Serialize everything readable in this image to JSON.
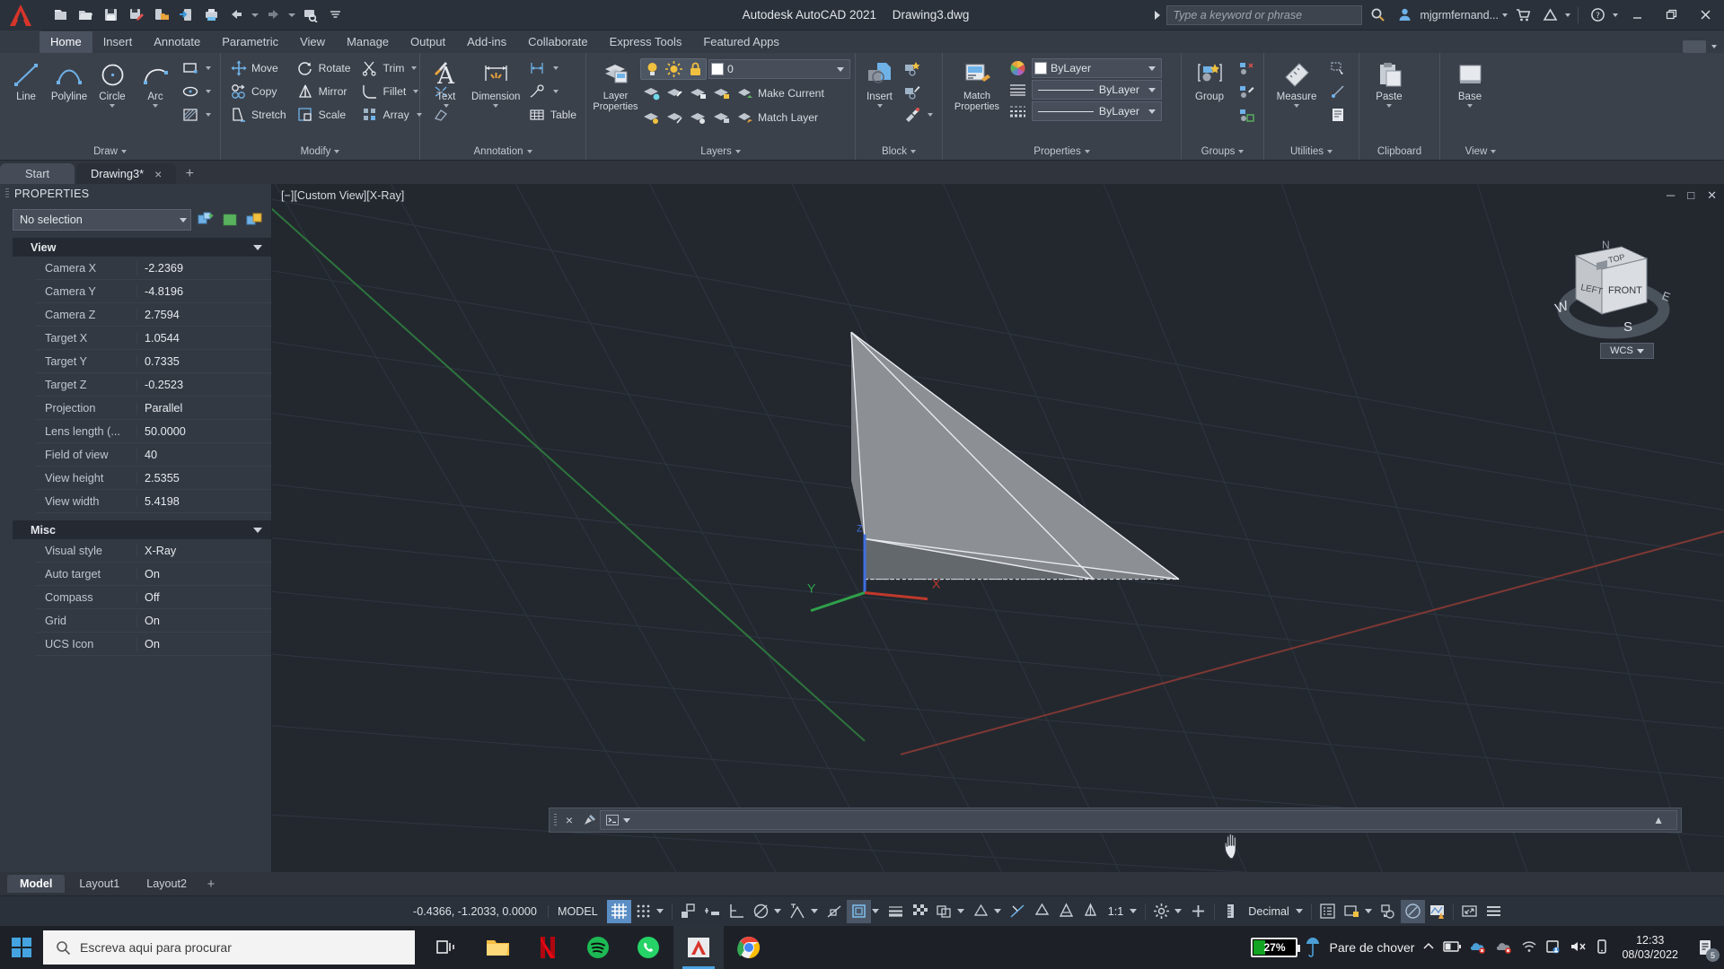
{
  "titlebar": {
    "app_title": "Autodesk AutoCAD 2021",
    "file_name": "Drawing3.dwg",
    "search_placeholder": "Type a keyword or phrase",
    "user_name": "mjgrmfernand...",
    "quick_access": [
      {
        "name": "new-file-icon",
        "label": "New"
      },
      {
        "name": "open-file-icon",
        "label": "Open"
      },
      {
        "name": "save-icon",
        "label": "Save"
      },
      {
        "name": "save-as-icon",
        "label": "Save As"
      },
      {
        "name": "save-to-web-icon",
        "label": "Save to Web & Mobile"
      },
      {
        "name": "open-from-web-icon",
        "label": "Open from Web & Mobile"
      },
      {
        "name": "plot-icon",
        "label": "Plot"
      },
      {
        "name": "undo-icon",
        "label": "Undo"
      },
      {
        "name": "redo-icon",
        "label": "Redo"
      },
      {
        "name": "plot-preview-icon",
        "label": "Plot Preview"
      },
      {
        "name": "customize-qat-icon",
        "label": "Customize Quick Access Toolbar"
      }
    ],
    "window_buttons": [
      "minimize",
      "restore",
      "close"
    ]
  },
  "ribbon": {
    "tabs": [
      {
        "label": "Home",
        "active": true
      },
      {
        "label": "Insert",
        "active": false
      },
      {
        "label": "Annotate",
        "active": false
      },
      {
        "label": "Parametric",
        "active": false
      },
      {
        "label": "View",
        "active": false
      },
      {
        "label": "Manage",
        "active": false
      },
      {
        "label": "Output",
        "active": false
      },
      {
        "label": "Add-ins",
        "active": false
      },
      {
        "label": "Collaborate",
        "active": false
      },
      {
        "label": "Express Tools",
        "active": false
      },
      {
        "label": "Featured Apps",
        "active": false
      }
    ],
    "panels": {
      "draw": {
        "title": "Draw",
        "big": [
          {
            "label": "Line",
            "icon": "line-icon"
          },
          {
            "label": "Polyline",
            "icon": "polyline-icon"
          },
          {
            "label": "Circle",
            "icon": "circle-icon"
          },
          {
            "label": "Arc",
            "icon": "arc-icon"
          }
        ],
        "small": [
          {
            "icon": "rectangle-icon",
            "label": ""
          },
          {
            "icon": "ellipse-icon",
            "label": ""
          },
          {
            "icon": "hatch-icon",
            "label": ""
          }
        ]
      },
      "modify": {
        "title": "Modify",
        "items": [
          {
            "label": "Move",
            "icon": "move-icon"
          },
          {
            "label": "Rotate",
            "icon": "rotate-icon"
          },
          {
            "label": "Trim",
            "icon": "trim-icon"
          },
          {
            "label": "Copy",
            "icon": "copy-icon"
          },
          {
            "label": "Mirror",
            "icon": "mirror-icon"
          },
          {
            "label": "Fillet",
            "icon": "fillet-icon"
          },
          {
            "label": "Stretch",
            "icon": "stretch-icon"
          },
          {
            "label": "Scale",
            "icon": "scale-icon"
          },
          {
            "label": "Array",
            "icon": "array-icon"
          }
        ],
        "extra": [
          {
            "icon": "paint-brush-icon"
          },
          {
            "icon": "erase-icon"
          },
          {
            "icon": "explode-icon"
          }
        ]
      },
      "annotation": {
        "title": "Annotation",
        "text_label": "Text",
        "dimension_label": "Dimension",
        "table_label": "Table"
      },
      "layers": {
        "title": "Layers",
        "layer_properties_label": "Layer\nProperties",
        "current_layer": "0",
        "make_current_label": "Make Current",
        "match_layer_label": "Match Layer"
      },
      "block": {
        "title": "Block",
        "insert_label": "Insert"
      },
      "properties": {
        "title": "Properties",
        "match_properties_label": "Match\nProperties",
        "color": "ByLayer",
        "linetype": "ByLayer",
        "lineweight": "ByLayer"
      },
      "groups": {
        "title": "Groups",
        "group_label": "Group"
      },
      "utilities": {
        "title": "Utilities",
        "measure_label": "Measure"
      },
      "clipboard": {
        "title": "Clipboard",
        "paste_label": "Paste"
      },
      "view": {
        "title": "View",
        "base_label": "Base"
      }
    }
  },
  "doc_tabs": [
    {
      "label": "Start",
      "active": false,
      "closable": false
    },
    {
      "label": "Drawing3*",
      "active": true,
      "closable": true
    }
  ],
  "properties_palette": {
    "title": "PROPERTIES",
    "selection": "No selection",
    "toolbar_icons": [
      "quick-select-icon",
      "select-objects-icon",
      "toggle-value-icon"
    ],
    "groups": [
      {
        "name": "View",
        "rows": [
          {
            "key": "Camera X",
            "value": "-2.2369"
          },
          {
            "key": "Camera Y",
            "value": "-4.8196"
          },
          {
            "key": "Camera Z",
            "value": "2.7594"
          },
          {
            "key": "Target X",
            "value": "1.0544"
          },
          {
            "key": "Target Y",
            "value": "0.7335"
          },
          {
            "key": "Target Z",
            "value": "-0.2523"
          },
          {
            "key": "Projection",
            "value": "Parallel"
          },
          {
            "key": "Lens length (...",
            "value": "50.0000"
          },
          {
            "key": "Field of view",
            "value": "40"
          },
          {
            "key": "View height",
            "value": "2.5355"
          },
          {
            "key": "View width",
            "value": "5.4198"
          }
        ]
      },
      {
        "name": "Misc",
        "rows": [
          {
            "key": "Visual style",
            "value": "X-Ray"
          },
          {
            "key": "Auto target",
            "value": "On"
          },
          {
            "key": "Compass",
            "value": "Off"
          },
          {
            "key": "Grid",
            "value": "On"
          },
          {
            "key": "UCS Icon",
            "value": "On"
          }
        ]
      }
    ]
  },
  "viewport": {
    "label": "[−][Custom View][X-Ray]",
    "window_controls": [
      "minimize",
      "restore",
      "close"
    ],
    "navcube": {
      "top": "TOP",
      "left": "LEFT",
      "front": "FRONT",
      "compass": [
        "N",
        "E",
        "S",
        "W"
      ]
    },
    "ucs_selector": "WCS",
    "cursor": "pan-hand-cursor"
  },
  "command_line": {
    "placeholder": "",
    "prompt_icon": "command-prompt-icon"
  },
  "layout_tabs": [
    {
      "label": "Model",
      "active": true
    },
    {
      "label": "Layout1",
      "active": false
    },
    {
      "label": "Layout2",
      "active": false
    }
  ],
  "status_bar": {
    "coordinates": "-0.4366, -1.2033, 0.0000",
    "space": "MODEL",
    "annotation_scale": "1:1",
    "units": "Decimal",
    "toggles": [
      {
        "name": "grid-display-toggle",
        "state": "on"
      },
      {
        "name": "snap-mode-toggle",
        "state": "off"
      },
      {
        "name": "infer-constraints-toggle",
        "state": "off"
      },
      {
        "name": "dynamic-input-toggle",
        "state": "off"
      },
      {
        "name": "ortho-mode-toggle",
        "state": "off"
      },
      {
        "name": "polar-tracking-toggle",
        "state": "off"
      },
      {
        "name": "isometric-drafting-toggle",
        "state": "off"
      },
      {
        "name": "object-snap-tracking-toggle",
        "state": "off"
      },
      {
        "name": "object-snap-toggle",
        "state": "off"
      },
      {
        "name": "lineweight-toggle",
        "state": "off"
      },
      {
        "name": "transparency-toggle",
        "state": "off"
      },
      {
        "name": "selection-cycling-toggle",
        "state": "off"
      },
      {
        "name": "3d-object-snap-toggle",
        "state": "off"
      },
      {
        "name": "dynamic-ucs-toggle",
        "state": "off"
      },
      {
        "name": "selection-filtering-toggle",
        "state": "off"
      },
      {
        "name": "gizmo-toggle",
        "state": "off"
      },
      {
        "name": "annotation-visibility-toggle",
        "state": "off"
      },
      {
        "name": "autoscale-toggle",
        "state": "off"
      },
      {
        "name": "workspace-switching-icon",
        "state": "off"
      },
      {
        "name": "annotation-monitor-icon",
        "state": "off"
      },
      {
        "name": "isolate-objects-icon",
        "state": "off"
      },
      {
        "name": "graphics-performance-icon",
        "state": "on"
      },
      {
        "name": "clean-screen-icon",
        "state": "off"
      },
      {
        "name": "customization-icon",
        "state": "off"
      }
    ]
  },
  "taskbar": {
    "search_placeholder": "Escreva aqui para procurar",
    "apps": [
      {
        "name": "task-view-icon"
      },
      {
        "name": "file-explorer-icon"
      },
      {
        "name": "netflix-icon"
      },
      {
        "name": "spotify-icon"
      },
      {
        "name": "whatsapp-icon"
      },
      {
        "name": "autocad-icon",
        "active": true
      },
      {
        "name": "chrome-icon"
      }
    ],
    "battery_percent": "27%",
    "weather": "Pare de chover",
    "time": "12:33",
    "date": "08/03/2022",
    "notification_count": "5",
    "tray_icons": [
      "show-hidden-icons",
      "battery-icon",
      "onedrive-error-icon",
      "onedrive-grey-error-icon",
      "wifi-icon",
      "network-icon",
      "volume-muted-icon",
      "mobile-icon"
    ]
  },
  "colors": {
    "accent": "#5b8ec4",
    "viewport_bg": "#23282f",
    "ribbon_bg": "#3b414b",
    "panel_bg": "#333943",
    "axis_x": "#c0392b",
    "axis_y": "#27ae60",
    "battery_green": "#12a422"
  }
}
